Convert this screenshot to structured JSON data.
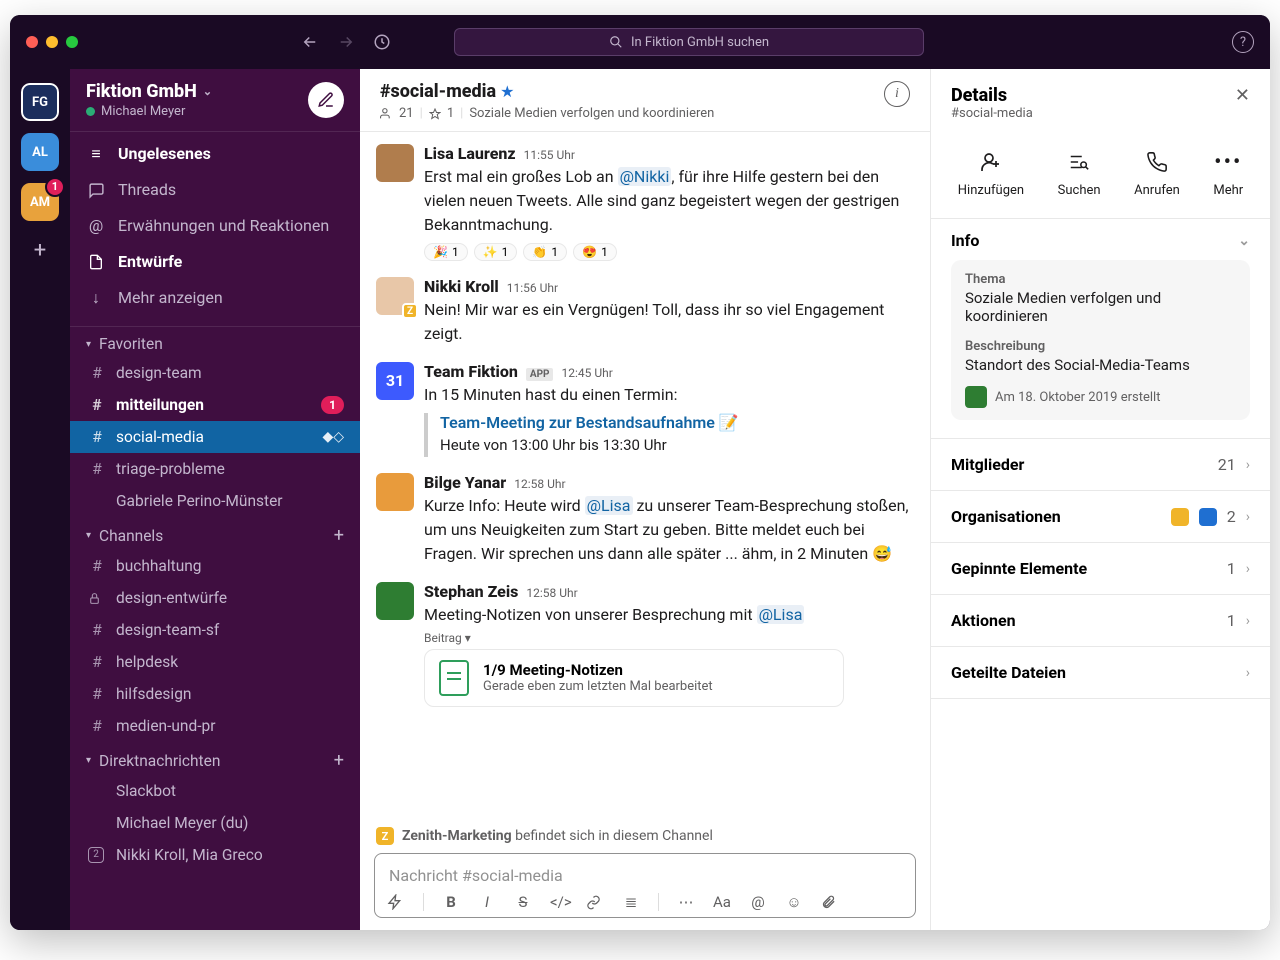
{
  "titlebar": {
    "search_placeholder": "In Fiktion GmbH suchen"
  },
  "workspaces": {
    "items": [
      {
        "label": "FG",
        "badge": ""
      },
      {
        "label": "AL",
        "badge": ""
      },
      {
        "label": "AM",
        "badge": "1"
      }
    ]
  },
  "sidebar": {
    "workspace_name": "Fiktion GmbH",
    "user_name": "Michael Meyer",
    "nav": {
      "unread": "Ungelesenes",
      "threads": "Threads",
      "mentions": "Erwähnungen und Reaktionen",
      "drafts": "Entwürfe",
      "more": "Mehr anzeigen"
    },
    "sections": {
      "favorites": "Favoriten",
      "channels": "Channels",
      "dms": "Direktnachrichten"
    },
    "favorites": [
      {
        "prefix": "#",
        "name": "design-team"
      },
      {
        "prefix": "#",
        "name": "mitteilungen",
        "bold": true,
        "badge": "1"
      },
      {
        "prefix": "#",
        "name": "social-media",
        "selected": true,
        "mark": true
      },
      {
        "prefix": "#",
        "name": "triage-probleme"
      },
      {
        "prefix": "●",
        "name": "Gabriele Perino-Münster"
      }
    ],
    "channels": [
      {
        "prefix": "#",
        "name": "buchhaltung"
      },
      {
        "prefix": "🔒",
        "name": "design-entwürfe"
      },
      {
        "prefix": "#",
        "name": "design-team-sf"
      },
      {
        "prefix": "#",
        "name": "helpdesk"
      },
      {
        "prefix": "#",
        "name": "hilfsdesign"
      },
      {
        "prefix": "#",
        "name": "medien-und-pr"
      }
    ],
    "dms": [
      {
        "prefix": "●",
        "name": "Slackbot"
      },
      {
        "prefix": "●",
        "name": "Michael Meyer (du)"
      },
      {
        "prefix": "2",
        "name": "Nikki Kroll, Mia Greco"
      }
    ]
  },
  "channel": {
    "name": "#social-media",
    "members": "21",
    "pins": "1",
    "topic": "Soziale Medien verfolgen und koordinieren"
  },
  "messages": [
    {
      "author": "Lisa Laurenz",
      "time": "11:55 Uhr",
      "text_pre": "Erst mal ein großes Lob an ",
      "mention": "@Nikki",
      "text_post": ", für ihre Hilfe gestern bei den vielen neuen Tweets. Alle sind ganz begeistert wegen der gestrigen Bekanntmachung.",
      "avatar_bg": "#b07d4d",
      "reactions": [
        {
          "emoji": "🎉",
          "count": "1"
        },
        {
          "emoji": "✨",
          "count": "1"
        },
        {
          "emoji": "👏",
          "count": "1"
        },
        {
          "emoji": "😍",
          "count": "1"
        }
      ]
    },
    {
      "author": "Nikki Kroll",
      "time": "11:56 Uhr",
      "text": "Nein! Mir war es ein Vergnügen! Toll, dass ihr so viel Engagement zeigt.",
      "avatar_bg": "#e8c7a8",
      "z": true
    },
    {
      "author": "Team Fiktion",
      "time": "12:45 Uhr",
      "app": true,
      "text": "In 15 Minuten hast du einen Termin:",
      "event_title": "Team-Meeting zur Bestandsaufnahme 📝",
      "event_time": "Heute von 13:00 Uhr bis 13:30 Uhr",
      "cal_day": "31"
    },
    {
      "author": "Bilge Yanar",
      "time": "12:58 Uhr",
      "text_pre": "Kurze Info: Heute wird ",
      "mention": "@Lisa",
      "text_post": " zu unserer Team-Besprechung stoßen, um uns Neuigkeiten zum Start zu geben. Bitte meldet euch bei Fragen. Wir sprechen uns dann alle später ... ähm, in 2 Minuten 😅",
      "avatar_bg": "#e89b3c"
    },
    {
      "author": "Stephan Zeis",
      "time": "12:58 Uhr",
      "text_pre": "Meeting-Notizen von unserer Besprechung mit ",
      "mention": "@Lisa",
      "text_post": "",
      "avatar_bg": "#2e7d32",
      "attach_label": "Beitrag ▾",
      "attach_title": "1/9 Meeting-Notizen",
      "attach_sub": "Gerade eben zum letzten Mal bearbeitet"
    }
  ],
  "org_note": {
    "name": "Zenith-Marketing",
    "text": " befindet sich in diesem Channel"
  },
  "composer": {
    "placeholder": "Nachricht #social-media"
  },
  "details": {
    "title": "Details",
    "channel": "#social-media",
    "actions": {
      "add": "Hinzufügen",
      "search": "Suchen",
      "call": "Anrufen",
      "more": "Mehr"
    },
    "info": {
      "header": "Info",
      "topic_label": "Thema",
      "topic": "Soziale Medien verfolgen und koordinieren",
      "desc_label": "Beschreibung",
      "desc": "Standort des Social-Media-Teams",
      "created": "Am 18. Oktober 2019 erstellt"
    },
    "rows": {
      "members": {
        "label": "Mitglieder",
        "value": "21"
      },
      "orgs": {
        "label": "Organisationen",
        "value": "2"
      },
      "pinned": {
        "label": "Gepinnte Elemente",
        "value": "1"
      },
      "actions": {
        "label": "Aktionen",
        "value": "1"
      },
      "files": {
        "label": "Geteilte Dateien",
        "value": ""
      }
    }
  }
}
